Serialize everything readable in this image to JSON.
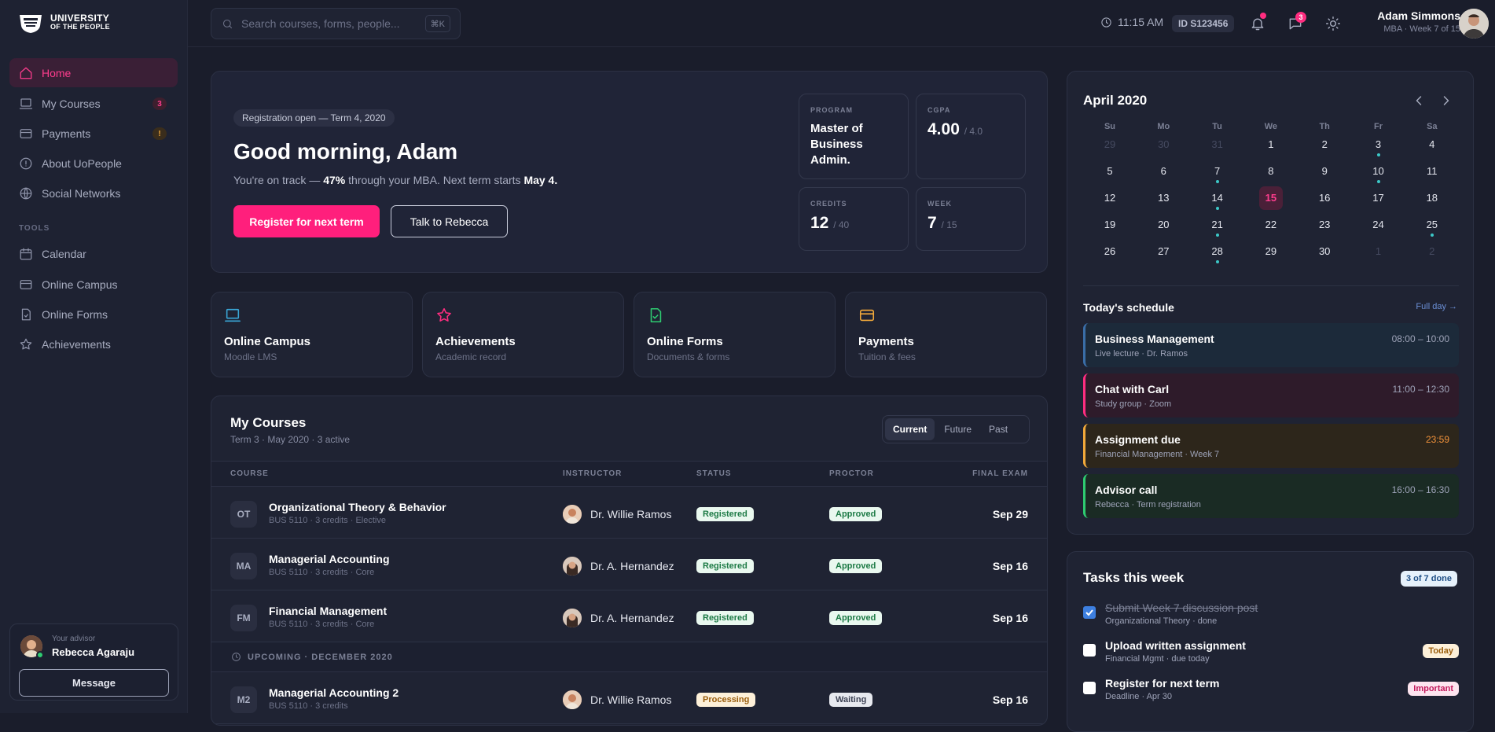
{
  "brand": {
    "line1": "UNIVERSITY",
    "line2": "OF THE PEOPLE"
  },
  "sidebar": {
    "items": [
      {
        "label": "Home",
        "icon": "home-icon",
        "active": true
      },
      {
        "label": "My Courses",
        "icon": "laptop-icon",
        "badge": "3"
      },
      {
        "label": "Payments",
        "icon": "card-icon",
        "badge": "!"
      },
      {
        "label": "About UoPeople",
        "icon": "info-icon"
      },
      {
        "label": "Social Networks",
        "icon": "globe-icon"
      }
    ],
    "tools_label": "TOOLS",
    "tools": [
      {
        "label": "Calendar",
        "icon": "calendar-icon"
      },
      {
        "label": "Online Campus",
        "icon": "card-icon"
      },
      {
        "label": "Online Forms",
        "icon": "file-icon"
      },
      {
        "label": "Achievements",
        "icon": "star-icon"
      }
    ],
    "advisor": {
      "caption": "Your advisor",
      "name": "Rebecca Agaraju",
      "button": "Message"
    }
  },
  "topbar": {
    "search_placeholder": "Search courses, forms, people...",
    "shortcut": "⌘K",
    "time": "11:15 AM",
    "student_id": "ID S123456",
    "messages_count": "3",
    "user_name": "Adam Simmons",
    "user_sub": "MBA · Week 7 of 15"
  },
  "hero": {
    "pill": "Registration open — Term 4, 2020",
    "greeting": "Good morning, Adam",
    "sub_pre": "You're on track — ",
    "sub_pct": "47%",
    "sub_mid": " through your MBA. Next term starts ",
    "sub_date": "May 4.",
    "primary": "Register for next term",
    "secondary": "Talk to Rebecca",
    "stats": {
      "program": {
        "label": "PROGRAM",
        "value": "Master of Business Admin."
      },
      "cgpa": {
        "label": "CGPA",
        "value": "4.00",
        "of": "/ 4.0"
      },
      "credits": {
        "label": "CREDITS",
        "value": "12",
        "of": "/ 40"
      },
      "week": {
        "label": "WEEK",
        "value": "7",
        "of": "/ 15"
      }
    }
  },
  "quicklinks": [
    {
      "title": "Online Campus",
      "sub": "Moodle LMS",
      "icon": "laptop-icon",
      "color": "#3aa6d6"
    },
    {
      "title": "Achievements",
      "sub": "Academic record",
      "icon": "star-icon",
      "color": "#ff2d80"
    },
    {
      "title": "Online Forms",
      "sub": "Documents & forms",
      "icon": "file-check-icon",
      "color": "#2ecc71"
    },
    {
      "title": "Payments",
      "sub": "Tuition & fees",
      "icon": "card-icon",
      "color": "#f2a93b"
    }
  ],
  "courses": {
    "title": "My Courses",
    "subtitle": "Term 3 · May 2020 · 3 active",
    "tabs": [
      "Current",
      "Future",
      "Past"
    ],
    "columns": [
      "COURSE",
      "INSTRUCTOR",
      "STATUS",
      "PROCTOR",
      "FINAL EXAM"
    ],
    "rows": [
      {
        "code": "OT",
        "name": "Organizational Theory & Behavior",
        "meta": "BUS 5110 · 3 credits · Elective",
        "instructor": "Dr. Willie Ramos",
        "status": "Registered",
        "proctor": "Approved",
        "exam": "Sep 29"
      },
      {
        "code": "MA",
        "name": "Managerial Accounting",
        "meta": "BUS 5110 · 3 credits · Core",
        "instructor": "Dr. A. Hernandez",
        "status": "Registered",
        "proctor": "Approved",
        "exam": "Sep 16"
      },
      {
        "code": "FM",
        "name": "Financial Management",
        "meta": "BUS 5110 · 3 credits · Core",
        "instructor": "Dr. A. Hernandez",
        "status": "Registered",
        "proctor": "Approved",
        "exam": "Sep 16"
      }
    ],
    "upcoming_label": "UPCOMING · DECEMBER 2020",
    "upcoming": {
      "code": "M2",
      "name": "Managerial Accounting 2",
      "meta": "BUS 5110 · 3 credits",
      "instructor": "Dr. Willie Ramos",
      "status": "Processing",
      "proctor": "Waiting",
      "exam": "Sep 16"
    }
  },
  "calendar": {
    "month": "April 2020",
    "dow": [
      "Su",
      "Mo",
      "Tu",
      "We",
      "Th",
      "Fr",
      "Sa"
    ],
    "weeks": [
      [
        "29",
        "30",
        "31",
        "1",
        "2",
        "3",
        "4"
      ],
      [
        "5",
        "6",
        "7",
        "8",
        "9",
        "10",
        "11"
      ],
      [
        "12",
        "13",
        "14",
        "15",
        "16",
        "17",
        "18"
      ],
      [
        "19",
        "20",
        "21",
        "22",
        "23",
        "24",
        "25"
      ],
      [
        "26",
        "27",
        "28",
        "29",
        "30",
        "1",
        "2"
      ]
    ]
  },
  "schedule": {
    "title": "Today's schedule",
    "link": "Full day →",
    "items": [
      {
        "title": "Business Management",
        "sub": "Live lecture · Dr. Ramos",
        "time": "08:00 – 10:00",
        "accent": "#3a6ea8",
        "bg": "#1c2a3a"
      },
      {
        "title": "Chat with Carl",
        "sub": "Study group · Zoom",
        "time": "11:00 – 12:30",
        "accent": "#ff2d80",
        "bg": "#2e1b2a"
      },
      {
        "title": "Assignment due",
        "sub": "Financial Management · Week 7",
        "time": "23:59",
        "accent": "#f2a93b",
        "bg": "#2d261b",
        "time_color": "#f2933b"
      },
      {
        "title": "Advisor call",
        "sub": "Rebecca · Term registration",
        "time": "16:00 – 16:30",
        "accent": "#2ecc71",
        "bg": "#1a2b24"
      }
    ]
  },
  "tasks": {
    "title": "Tasks this week",
    "count": "3 of 7 done",
    "items": [
      {
        "title": "Submit Week 7 discussion post",
        "sub": "Organizational Theory · done",
        "done": true
      },
      {
        "title": "Upload written assignment",
        "sub": "Financial Mgmt · due today",
        "tag": "Today"
      },
      {
        "title": "Register for next term",
        "sub": "Deadline · Apr 30",
        "tag": "Important"
      }
    ]
  }
}
